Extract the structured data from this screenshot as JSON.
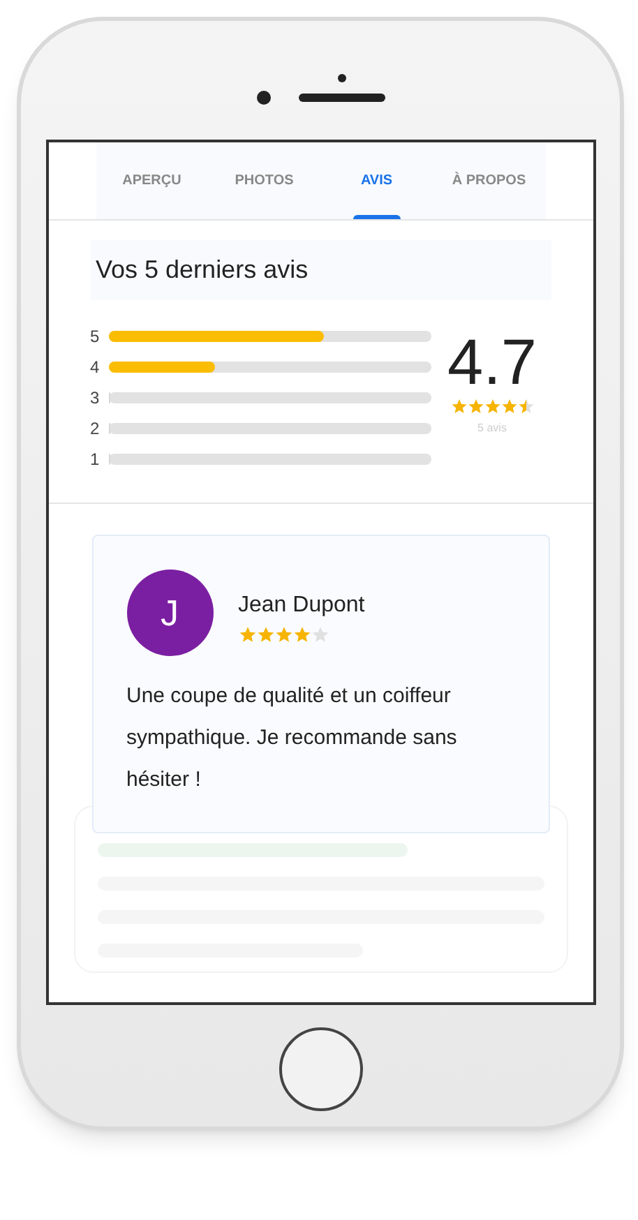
{
  "tabs": [
    {
      "label": "APERÇU",
      "selected": false
    },
    {
      "label": "PHOTOS",
      "selected": false
    },
    {
      "label": "AVIS",
      "selected": true
    },
    {
      "label": "À PROPOS",
      "selected": false
    }
  ],
  "summary": {
    "title": "Vos 5 derniers avis",
    "rating": "4.7",
    "stars": 4.5,
    "count": "5 avis",
    "bars": [
      {
        "label": "5",
        "level": 0.67
      },
      {
        "label": "4",
        "level": 0.33
      },
      {
        "label": "3",
        "level": 0
      },
      {
        "label": "2",
        "level": 0
      },
      {
        "label": "1",
        "level": 0
      }
    ]
  },
  "review": {
    "initial": "J",
    "name": "Jean Dupont",
    "stars": 4,
    "text": "Une coupe de qualité et un coiffeur sympathique. Je recommande sans hésiter !"
  }
}
